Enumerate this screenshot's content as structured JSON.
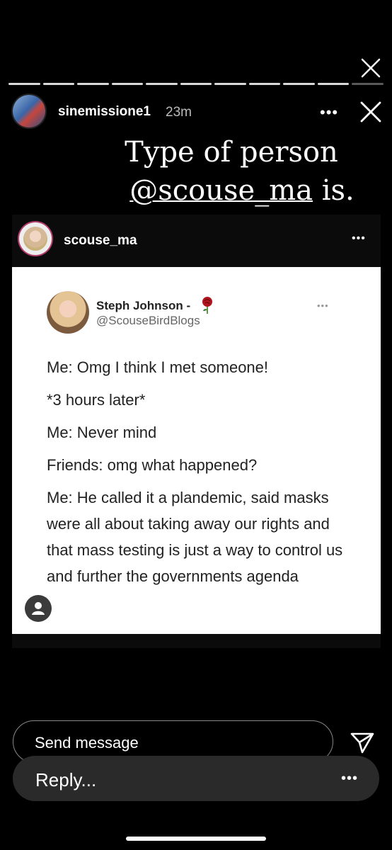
{
  "progress": {
    "total": 11,
    "viewed": 10
  },
  "story": {
    "username": "sinemissione1",
    "time": "23m",
    "caption_line1": "Type of person",
    "caption_mention": "@scouse_ma",
    "caption_rest": " is."
  },
  "post": {
    "username": "scouse_ma",
    "more": "•••"
  },
  "tweet": {
    "name": "Steph Johnson -",
    "handle": "@ScouseBirdBlogs",
    "more": "•••",
    "lines": [
      "Me: Omg I think I met someone!",
      "*3 hours later*",
      "Me: Never mind",
      "Friends: omg what happened?",
      "Me: He called it a plandemic, said masks were all about taking away our rights and that mass testing is just a way to control us and further the governments agenda"
    ]
  },
  "composer": {
    "send_placeholder": "Send message",
    "reply_placeholder": "Reply...",
    "more": "•••"
  },
  "icons": {
    "close": "close-icon",
    "send": "send-icon",
    "more": "more-icon",
    "person": "person-icon",
    "rose": "rose-icon"
  }
}
